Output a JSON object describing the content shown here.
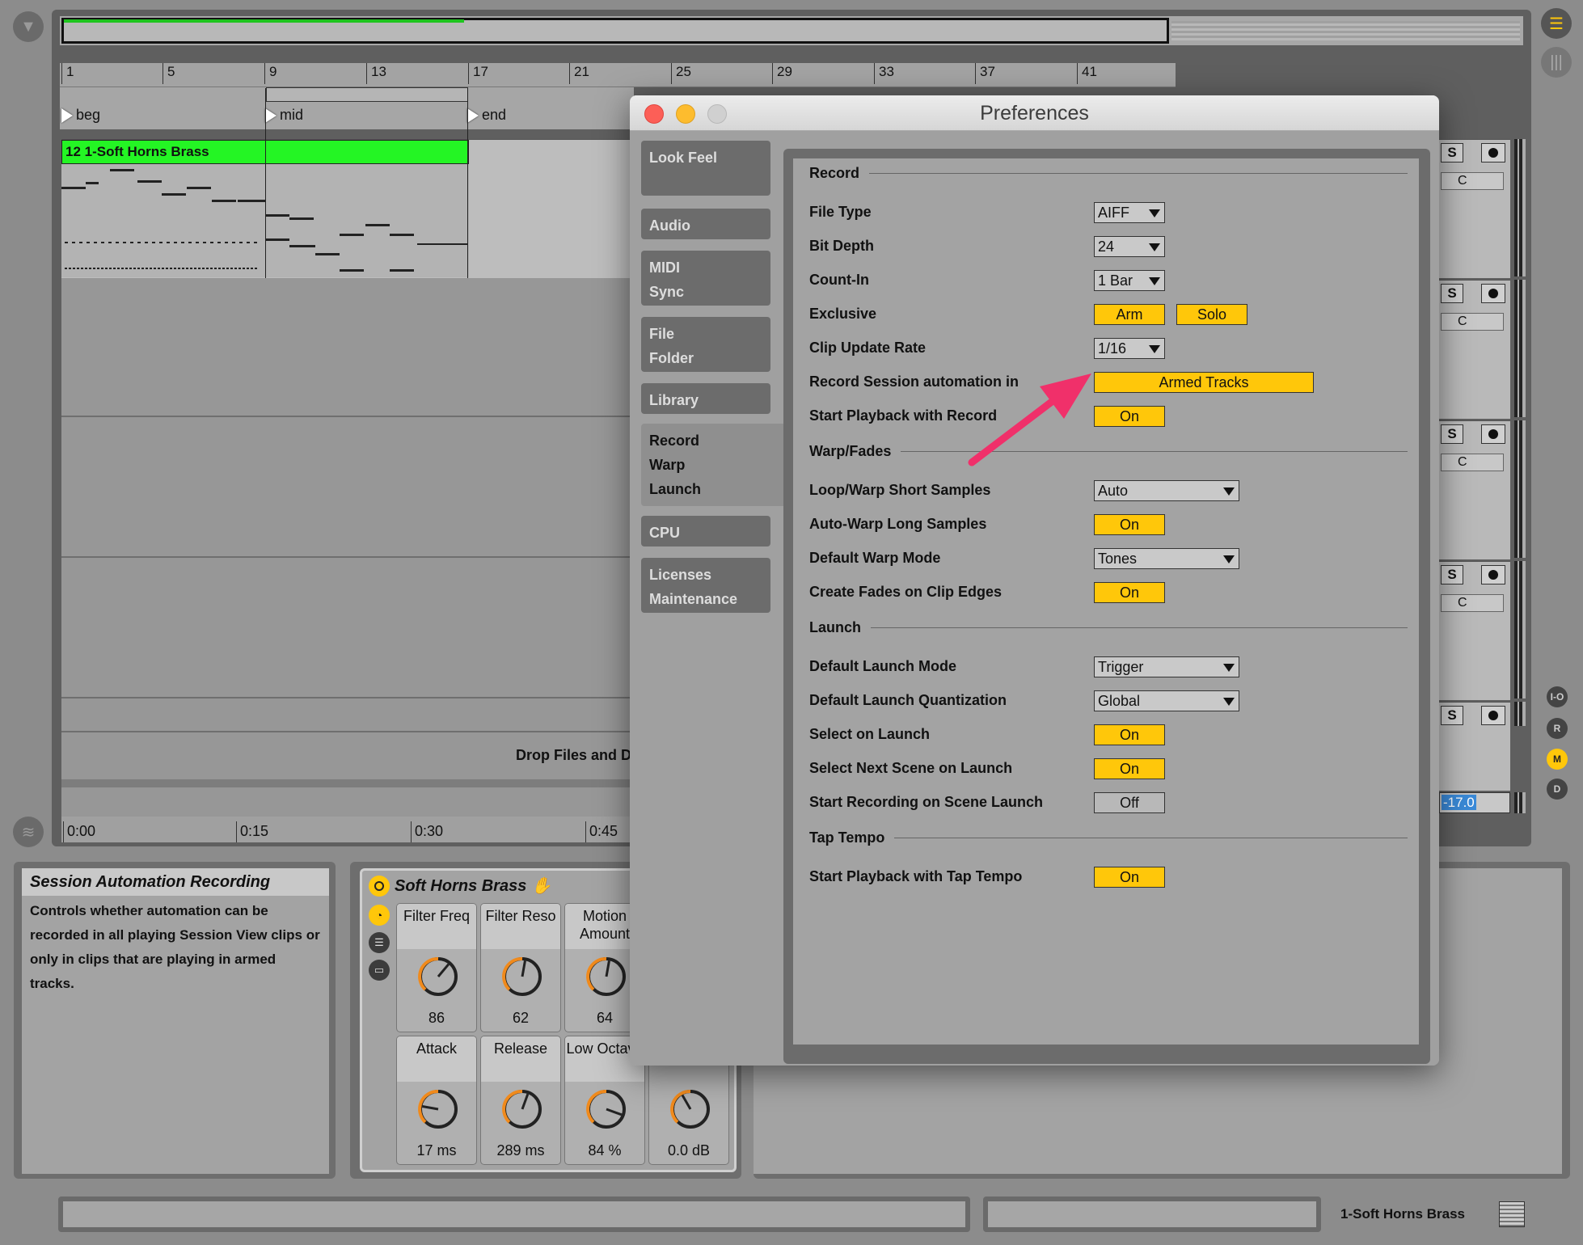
{
  "arrangement": {
    "ruler_bars": [
      "1",
      "5",
      "9",
      "13",
      "17",
      "21",
      "25",
      "29",
      "33",
      "37",
      "41"
    ],
    "locators": [
      "beg",
      "mid",
      "end"
    ],
    "clip_name": "12 1-Soft Horns Brass",
    "drop_message": "Drop Files and D",
    "time_ticks": [
      "0:00",
      "0:15",
      "0:30",
      "0:45"
    ],
    "clip_color": "#24f524"
  },
  "mixer_strip": {
    "solo_label": "S",
    "crossfade_label": "C",
    "volume_value": "-17.0",
    "side_buttons": [
      "I-O",
      "R",
      "M",
      "D"
    ]
  },
  "info_view": {
    "title": "Session Automation Recording",
    "body": "Controls whether automation can be recorded in all playing Session View clips or only in clips that are playing in armed tracks."
  },
  "device": {
    "name": "Soft Horns Brass",
    "knobs": [
      {
        "label": "Filter Freq",
        "value": "86"
      },
      {
        "label": "Filter Reso",
        "value": "62"
      },
      {
        "label": "Motion Amount",
        "value": "64"
      },
      {
        "label": "Attack",
        "value": "17 ms"
      },
      {
        "label": "Release",
        "value": "289 ms"
      },
      {
        "label": "Low Octave",
        "value": "84 %"
      },
      {
        "label": "",
        "value": "0.0 dB"
      }
    ]
  },
  "status_bar": {
    "selected_track": "1-Soft Horns Brass"
  },
  "preferences": {
    "title": "Preferences",
    "tabs": [
      {
        "label": "Look Feel"
      },
      {
        "label": "Audio"
      },
      {
        "label": "MIDI Sync"
      },
      {
        "label": "File Folder"
      },
      {
        "label": "Library"
      },
      {
        "label": "Record Warp Launch",
        "active": true
      },
      {
        "label": "CPU"
      },
      {
        "label": "Licenses Maintenance"
      }
    ],
    "sections": {
      "record": "Record",
      "warp": "Warp/Fades",
      "launch": "Launch",
      "tap": "Tap Tempo"
    },
    "rows": {
      "file_type": {
        "label": "File Type",
        "value": "AIFF"
      },
      "bit_depth": {
        "label": "Bit Depth",
        "value": "24"
      },
      "count_in": {
        "label": "Count-In",
        "value": "1 Bar"
      },
      "exclusive": {
        "label": "Exclusive",
        "arm": "Arm",
        "solo": "Solo"
      },
      "clip_update": {
        "label": "Clip Update Rate",
        "value": "1/16"
      },
      "session_auto": {
        "label": "Record Session automation in",
        "value": "Armed Tracks"
      },
      "start_playback_record": {
        "label": "Start Playback with Record",
        "value": "On"
      },
      "loop_warp": {
        "label": "Loop/Warp Short Samples",
        "value": "Auto"
      },
      "auto_warp": {
        "label": "Auto-Warp Long Samples",
        "value": "On"
      },
      "warp_mode": {
        "label": "Default Warp Mode",
        "value": "Tones"
      },
      "fades": {
        "label": "Create Fades on Clip Edges",
        "value": "On"
      },
      "launch_mode": {
        "label": "Default Launch Mode",
        "value": "Trigger"
      },
      "launch_quant": {
        "label": "Default Launch Quantization",
        "value": "Global"
      },
      "select_launch": {
        "label": "Select on Launch",
        "value": "On"
      },
      "select_next": {
        "label": "Select Next Scene on Launch",
        "value": "On"
      },
      "start_rec_scene": {
        "label": "Start Recording on Scene Launch",
        "value": "Off"
      },
      "tap_playback": {
        "label": "Start Playback with Tap Tempo",
        "value": "On"
      }
    },
    "accent_color": "#ffc70a",
    "annotation_arrow_color": "#f0306a"
  }
}
